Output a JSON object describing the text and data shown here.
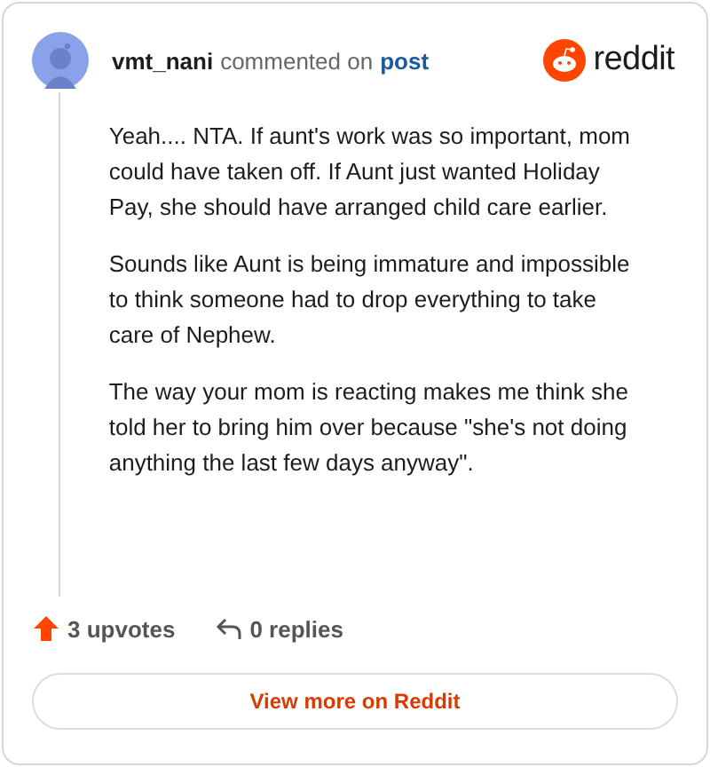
{
  "author": {
    "username": "vmt_nani",
    "action": "commented on",
    "target": "post"
  },
  "brand": "reddit",
  "paragraphs": [
    "Yeah.... NTA. If aunt's work was so important, mom could have taken off. If Aunt just wanted Holiday Pay, she should have arranged child care earlier.",
    "Sounds like Aunt is being immature and impossible to think someone had to drop everything to take care of Nephew.",
    "The way your mom is reacting makes me think she told her to bring him over because \"she's not doing anything the last few days anyway\"."
  ],
  "stats": {
    "upvotes": "3 upvotes",
    "replies": "0 replies"
  },
  "button": "View more on Reddit"
}
